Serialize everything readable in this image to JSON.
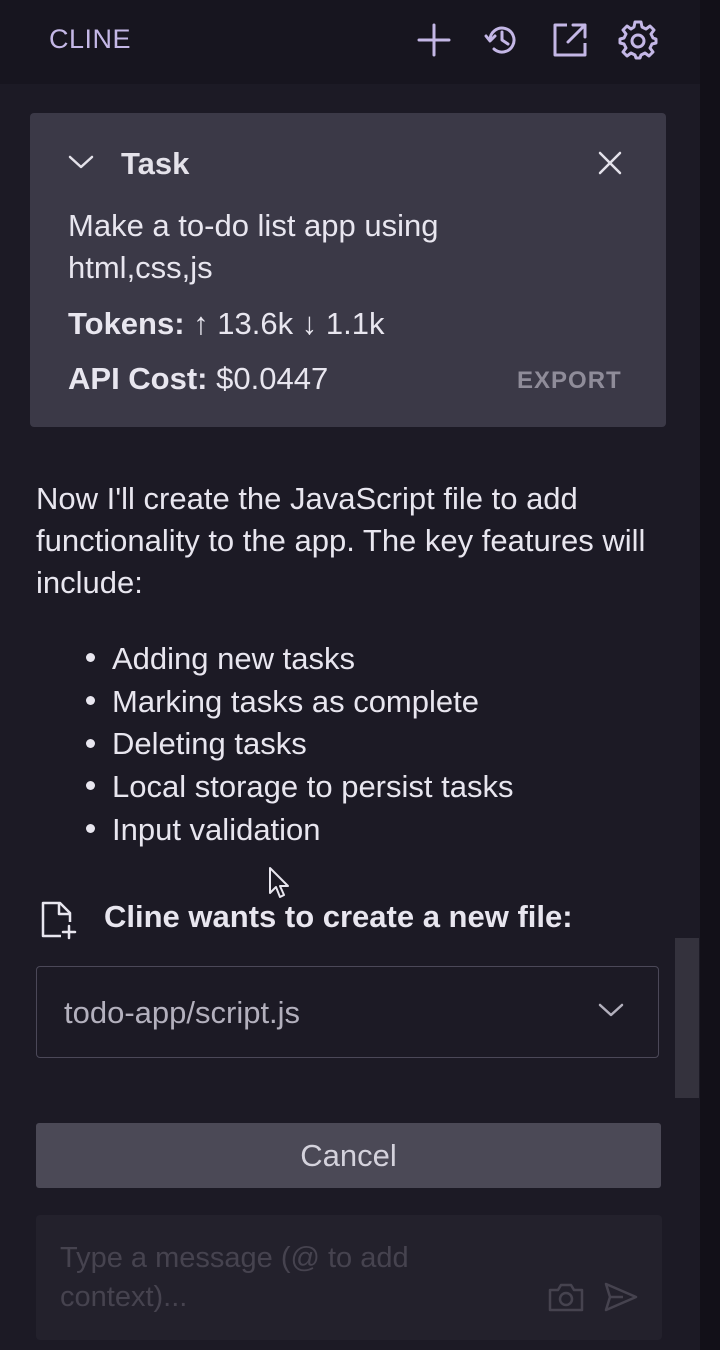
{
  "app": {
    "title": "CLINE"
  },
  "toolbar": {
    "icons": [
      "plus-icon",
      "history-icon",
      "popout-icon",
      "gear-icon"
    ]
  },
  "task": {
    "header": "Task",
    "description": "Make a to-do list app using html,css,js",
    "tokens_label": "Tokens:",
    "tokens_up": "↑ 13.6k",
    "tokens_down": "↓ 1.1k",
    "cost_label": "API Cost:",
    "cost_value": "$0.0447",
    "export_label": "EXPORT"
  },
  "message": {
    "intro": "Now I'll create the JavaScript file to add functionality to the app. The key features will include:",
    "features": [
      "Adding new tasks",
      "Marking tasks as complete",
      "Deleting tasks",
      "Local storage to persist tasks",
      "Input validation"
    ]
  },
  "tool": {
    "label": "Cline wants to create a new file:",
    "file_path": "todo-app/script.js"
  },
  "actions": {
    "cancel_label": "Cancel"
  },
  "chat": {
    "placeholder": "Type a message (@ to add context)..."
  },
  "colors": {
    "background": "#1c1a25",
    "card": "#3b3947",
    "brand": "#c4b7e6",
    "button": "#4b4956"
  }
}
